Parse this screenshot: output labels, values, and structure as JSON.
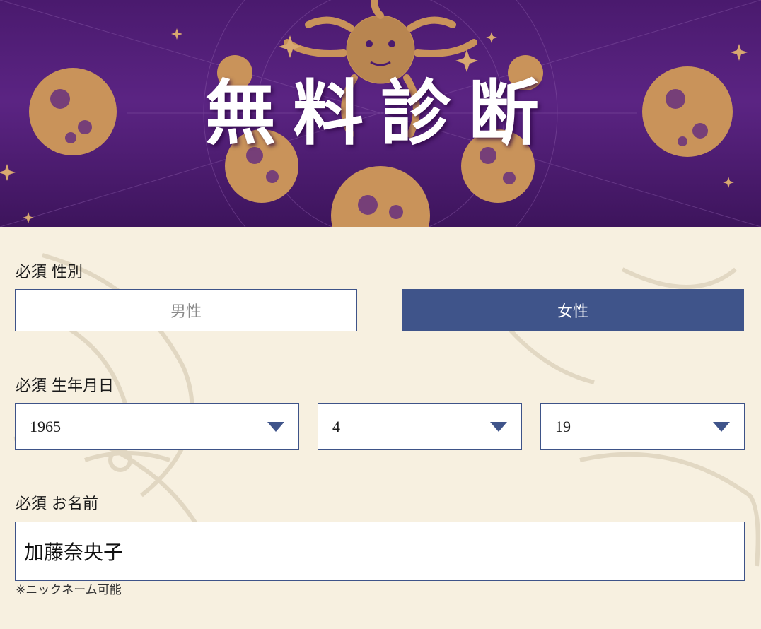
{
  "banner": {
    "title": "無料診断"
  },
  "gender": {
    "label": "必須 性別",
    "options": [
      "男性",
      "女性"
    ],
    "selected": "女性"
  },
  "birthdate": {
    "label": "必須 生年月日",
    "year": "1965",
    "month": "4",
    "day": "19"
  },
  "name": {
    "label": "必須 お名前",
    "value": "加藤奈央子",
    "note": "※ニックネーム可能"
  },
  "colors": {
    "accent": "#3f548a",
    "banner_purple": "#5b2483",
    "gold": "#c9935a",
    "background": "#f7f0e0"
  },
  "icons": [
    "chevron-down-icon",
    "sun-icon",
    "moon-icon",
    "star-icon"
  ]
}
